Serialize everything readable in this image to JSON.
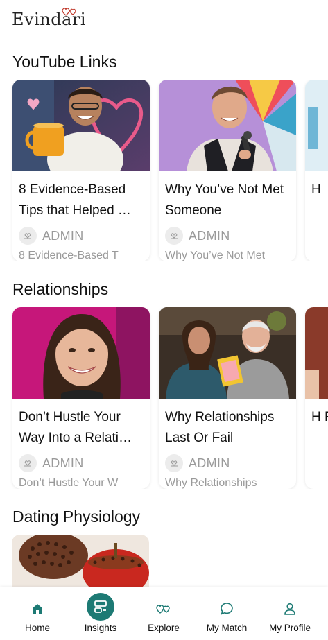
{
  "app": {
    "logo_text": "Evindari"
  },
  "sections": [
    {
      "title": "YouTube Links",
      "cards": [
        {
          "title": "8 Evidence-Based Tips that Helped …",
          "author": "ADMIN",
          "excerpt": "8 Evidence-Based T"
        },
        {
          "title": "Why You’ve Not Met Someone",
          "author": "ADMIN",
          "excerpt": "Why You’ve Not Met"
        },
        {
          "title": "H",
          "author": "",
          "excerpt": ""
        }
      ]
    },
    {
      "title": "Relationships",
      "cards": [
        {
          "title": "Don’t Hustle Your Way Into a Relati…",
          "author": "ADMIN",
          "excerpt": "Don’t Hustle Your W"
        },
        {
          "title": "Why Relationships Last Or Fail",
          "author": "ADMIN",
          "excerpt": "Why Relationships"
        },
        {
          "title": "H F",
          "author": "",
          "excerpt": ""
        }
      ]
    },
    {
      "title": "Dating Physiology",
      "cards": []
    }
  ],
  "nav": [
    {
      "label": "Home",
      "icon": "home-icon"
    },
    {
      "label": "Insights",
      "icon": "insights-icon"
    },
    {
      "label": "Explore",
      "icon": "explore-icon"
    },
    {
      "label": "My Match",
      "icon": "chat-bubble-icon"
    },
    {
      "label": "My Profile",
      "icon": "profile-icon"
    }
  ],
  "colors": {
    "accent": "#1d7a74",
    "muted_text": "#9a9a9a",
    "logo_heart": "#c0392b"
  }
}
